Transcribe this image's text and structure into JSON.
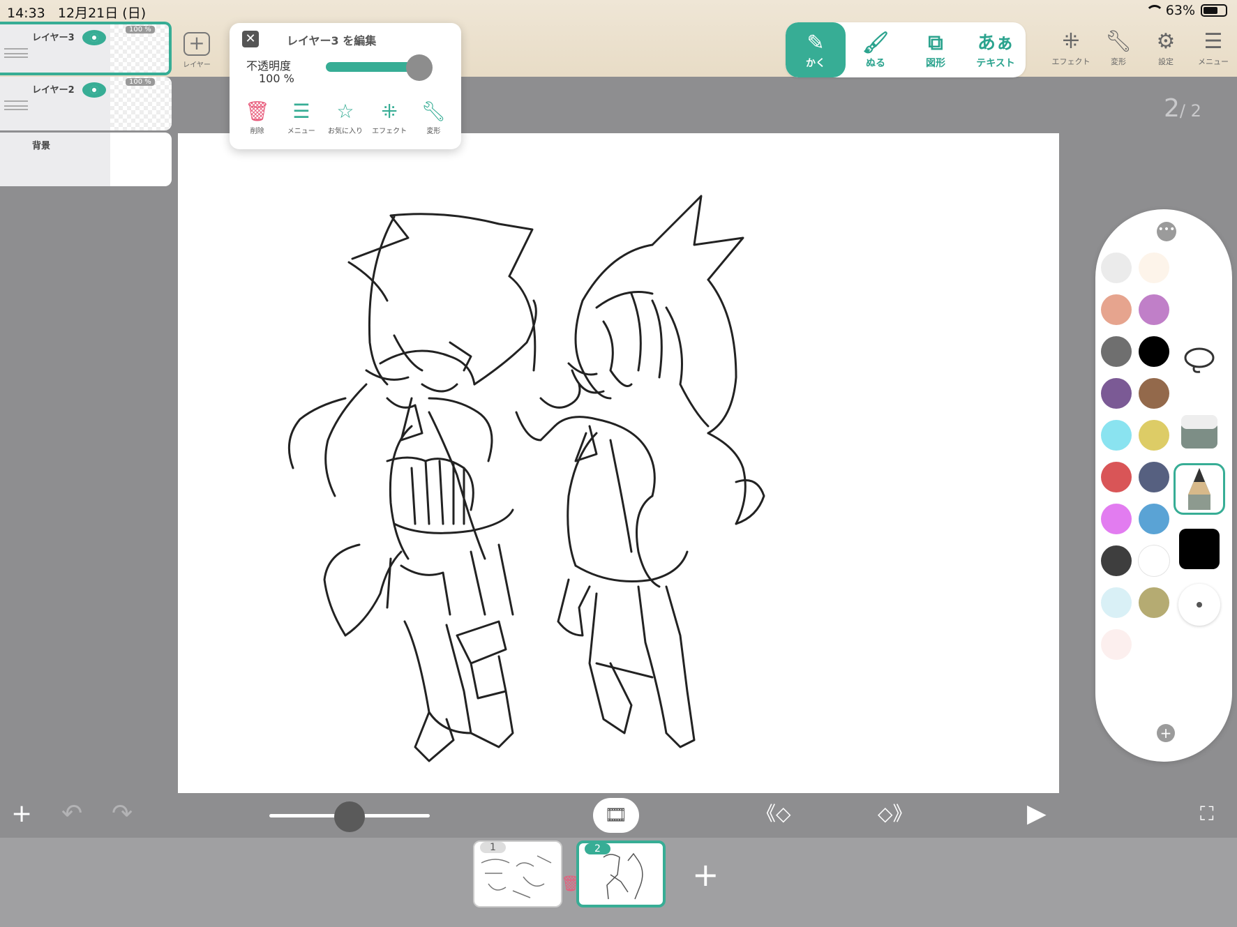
{
  "status": {
    "time": "14:33",
    "date": "12月21日 (日)",
    "battery": "63%"
  },
  "layers": [
    {
      "name": "レイヤー3",
      "opacity": "100 %",
      "selected": true
    },
    {
      "name": "レイヤー2",
      "opacity": "100 %",
      "selected": false
    },
    {
      "name": "背景"
    }
  ],
  "add_layer_label": "レイヤー",
  "edit_popup": {
    "title": "レイヤー3 を編集",
    "opacity_label": "不透明度",
    "opacity_value": "100 %",
    "opacity_fraction": 1.0,
    "actions": [
      {
        "label": "削除",
        "icon": "trash-icon"
      },
      {
        "label": "メニュー",
        "icon": "hamburger-icon"
      },
      {
        "label": "お気に入り",
        "icon": "star-icon"
      },
      {
        "label": "エフェクト",
        "icon": "sparkle-icon"
      },
      {
        "label": "変形",
        "icon": "wrench-icon"
      }
    ]
  },
  "draw_tools": [
    {
      "label": "かく",
      "icon": "pencil-icon",
      "active": true
    },
    {
      "label": "ぬる",
      "icon": "brush-icon",
      "active": false
    },
    {
      "label": "図形",
      "icon": "shape-icon",
      "active": false
    },
    {
      "label": "テキスト",
      "icon": "text-icon",
      "glyph": "あぁ",
      "active": false
    }
  ],
  "right_tools": [
    {
      "label": "エフェクト",
      "icon": "sparkle-icon"
    },
    {
      "label": "変形",
      "icon": "wrench-icon"
    },
    {
      "label": "設定",
      "icon": "gear-icon"
    },
    {
      "label": "メニュー",
      "icon": "hamburger-icon"
    }
  ],
  "page_indicator": {
    "current": "2",
    "total": "/ 2"
  },
  "palette_colors": [
    "#ebebeb",
    "#fdf4ea",
    "#e6a48e",
    "#c07fc8",
    "#6f6f6f",
    "#000000",
    "#7b5a95",
    "#93694b",
    "#8ae3f0",
    "#ddcc66",
    "#d95557",
    "#566080",
    "#e27cf0",
    "#5aa3d5",
    "#3e3e3e",
    "#ffffff",
    "#d9f0f6",
    "#b5ab72",
    "#fcefee"
  ],
  "accent_color": "#37ad95",
  "frames": [
    {
      "number": "1"
    },
    {
      "number": "2",
      "selected": true
    }
  ]
}
